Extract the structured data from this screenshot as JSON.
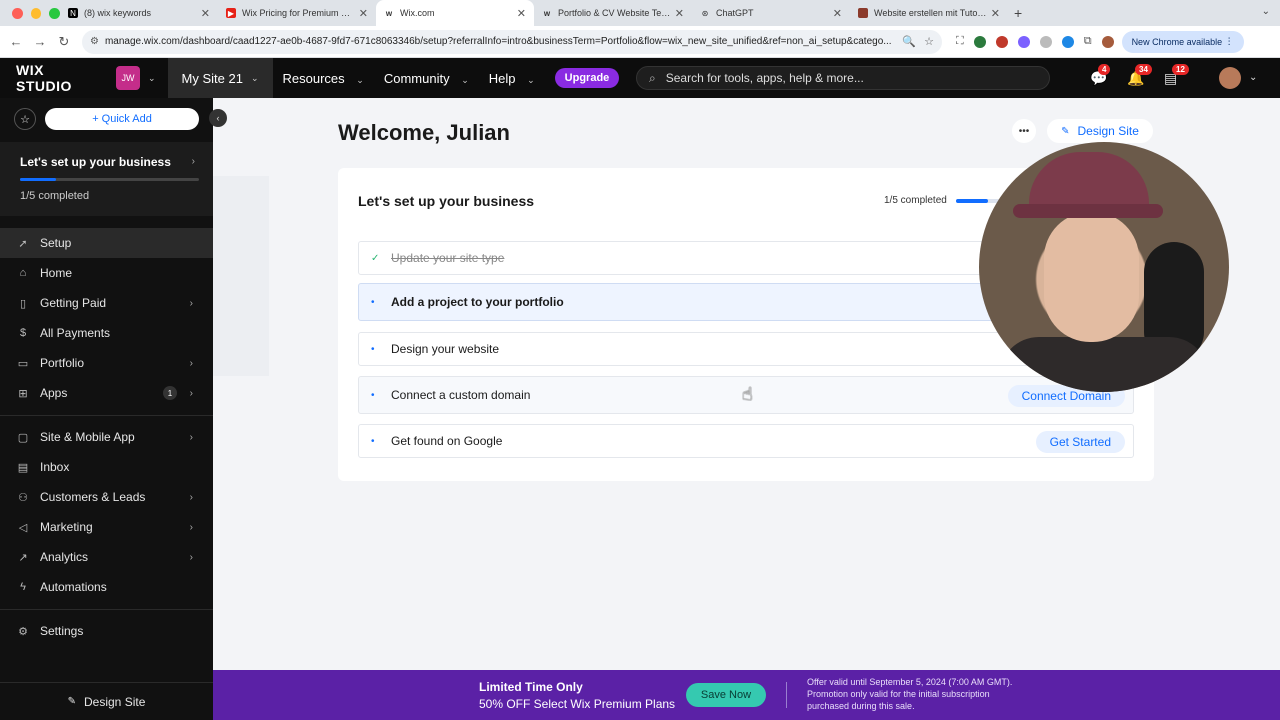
{
  "browser": {
    "tabs": [
      {
        "title": "(8) wix keywords",
        "favicon": "notion-icon"
      },
      {
        "title": "Wix Pricing for Premium Plans",
        "favicon": "youtube-icon"
      },
      {
        "title": "Wix.com",
        "favicon": "wix-icon"
      },
      {
        "title": "Portfolio & CV Website Templates",
        "favicon": "wix-icon"
      },
      {
        "title": "ChatGPT",
        "favicon": "chatgpt-icon"
      },
      {
        "title": "Website erstellen mit Tutorials",
        "favicon": "site-icon"
      }
    ],
    "url": "manage.wix.com/dashboard/caad1227-ae0b-4687-9fd7-671c8063346b/setup?referralInfo=intro&businessTerm=Portfolio&flow=wix_new_site_unified&ref=non_ai_setup&catego...",
    "new_chrome_label": "New Chrome available"
  },
  "topbar": {
    "logo": "WIX STUDIO",
    "site_badge": "JW",
    "site_name": "My Site 21",
    "nav": [
      "Resources",
      "Community",
      "Help"
    ],
    "upgrade_label": "Upgrade",
    "search_placeholder": "Search for tools, apps, help & more...",
    "badges": {
      "chat": "4",
      "notifications": "34",
      "updates": "12"
    }
  },
  "sidebar": {
    "quick_add": "Quick Add",
    "setup_title": "Let's set up your business",
    "setup_progress_text": "1/5 completed",
    "setup_progress": 0.2,
    "items": [
      {
        "label": "Setup",
        "icon": "rocket-icon"
      },
      {
        "label": "Home",
        "icon": "home-icon"
      },
      {
        "label": "Getting Paid",
        "icon": "receipt-icon"
      },
      {
        "label": "All Payments",
        "icon": "dollar-icon"
      },
      {
        "label": "Portfolio",
        "icon": "folder-icon"
      },
      {
        "label": "Apps",
        "icon": "apps-icon",
        "count": "1"
      },
      {
        "label": "Site & Mobile App",
        "icon": "site-icon"
      },
      {
        "label": "Inbox",
        "icon": "inbox-icon"
      },
      {
        "label": "Customers & Leads",
        "icon": "people-icon"
      },
      {
        "label": "Marketing",
        "icon": "megaphone-icon"
      },
      {
        "label": "Analytics",
        "icon": "chart-icon"
      },
      {
        "label": "Automations",
        "icon": "automation-icon"
      },
      {
        "label": "Settings",
        "icon": "gear-icon"
      }
    ],
    "design_site": "Design Site"
  },
  "main": {
    "welcome": "Welcome, Julian",
    "design_site": "Design Site",
    "card_title": "Let's set up your business",
    "progress_text": "1/5 completed",
    "progress": 0.2,
    "tasks": [
      {
        "label": "Update your site type",
        "done": true
      },
      {
        "label": "Add a project to your portfolio",
        "done": false
      },
      {
        "label": "Design your website",
        "done": false
      },
      {
        "label": "Connect a custom domain",
        "done": false,
        "action": "Connect Domain"
      },
      {
        "label": "Get found on Google",
        "done": false,
        "action": "Get Started"
      }
    ]
  },
  "promo": {
    "headline": "Limited Time Only",
    "subline": "50% OFF Select Wix Premium Plans",
    "button": "Save Now",
    "fine_print": "Offer valid until September 5, 2024 (7:00 AM GMT). Promotion only valid for the initial subscription purchased during this sale."
  },
  "colors": {
    "accent": "#116dff",
    "promo_bg": "#5b21a6",
    "upgrade": "#8a2be2",
    "sidebar_bg": "#111111"
  }
}
